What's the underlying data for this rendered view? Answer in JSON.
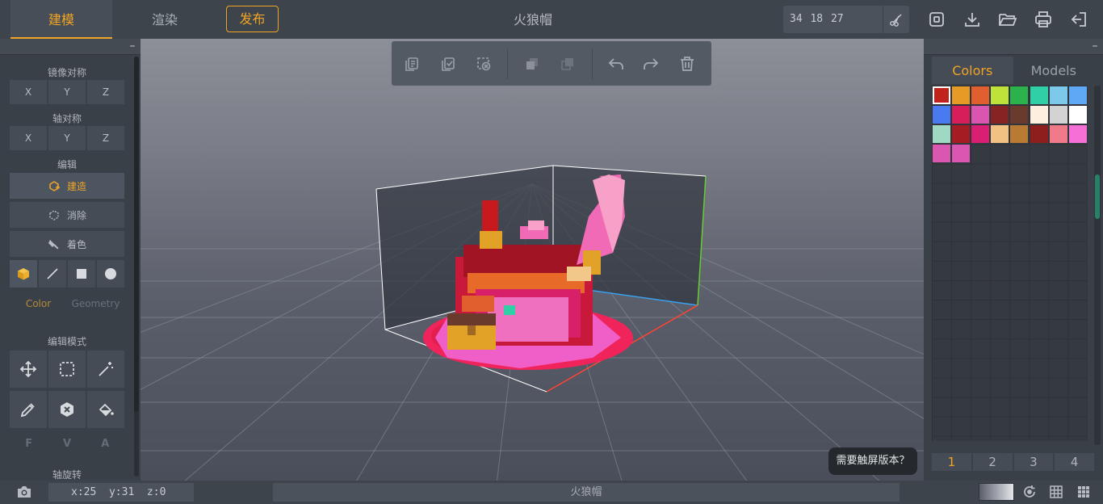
{
  "header": {
    "tabs": [
      {
        "label": "建模",
        "active": true
      },
      {
        "label": "渲染",
        "active": false
      }
    ],
    "publish_label": "发布",
    "title": "火狼帽",
    "dimensions": "34 18 27",
    "icons": [
      "scissors-icon",
      "save-icon",
      "download-icon",
      "open-folder-icon",
      "print-icon",
      "exit-icon"
    ]
  },
  "left_panel": {
    "mirror_label": "镜像对称",
    "mirror_axes": [
      "X",
      "Y",
      "Z"
    ],
    "axis_sym_label": "轴对称",
    "axis_sym_axes": [
      "X",
      "Y",
      "Z"
    ],
    "edit_label": "编辑",
    "tools": [
      {
        "label": "建造",
        "icon": "build-icon",
        "active": true
      },
      {
        "label": "消除",
        "icon": "erase-icon",
        "active": false
      },
      {
        "label": "着色",
        "icon": "paint-icon",
        "active": false
      }
    ],
    "shapes": [
      "cube-icon",
      "line-icon",
      "square-icon",
      "circle-icon"
    ],
    "mode_tabs": [
      {
        "label": "Color",
        "active": true
      },
      {
        "label": "Geometry",
        "active": false
      }
    ],
    "edit_mode_label": "编辑模式",
    "edit_mode_tools": [
      "move-icon",
      "select-rect-icon",
      "magic-wand-icon",
      "eyedropper-icon",
      "delete-hex-icon",
      "fill-bucket-icon"
    ],
    "fva": [
      "F",
      "V",
      "A"
    ],
    "rotate_label": "轴旋转"
  },
  "viewport": {
    "toolbar_icons": [
      "copy-icon",
      "paste-check-icon",
      "cut-clear-icon",
      "duplicate-icon",
      "merge-icon",
      "undo-icon",
      "redo-icon",
      "trash-icon"
    ],
    "touch_tip": "需要触屏版本？"
  },
  "right_panel": {
    "tabs": [
      {
        "label": "Colors",
        "active": true
      },
      {
        "label": "Models",
        "active": false
      }
    ],
    "palette": [
      "#c0221c",
      "#e89a26",
      "#e15f2e",
      "#bfe23a",
      "#2bb24c",
      "#2fd0a6",
      "#7cc9ec",
      "#5ea8f5",
      "#4a7af0",
      "#d81e5a",
      "#d955b0",
      "#862424",
      "#6a3a2c",
      "#fdeee0",
      "#d3d3d3",
      "#ffffff",
      "#9fd8c3",
      "#a51d23",
      "#d81f73",
      "#f1c184",
      "#b97a33",
      "#8e1e1e",
      "#f07a88",
      "#f46fd6",
      "#d957b0",
      "#d957b0"
    ],
    "selected_index": 0,
    "pages": [
      {
        "label": "1",
        "active": true
      },
      {
        "label": "2",
        "active": false
      },
      {
        "label": "3",
        "active": false
      },
      {
        "label": "4",
        "active": false
      }
    ]
  },
  "status_bar": {
    "coords": "x:25  y:31  z:0",
    "title": "火狼帽",
    "icons": [
      "camera-icon",
      "gradient-swatch",
      "rotate-icon",
      "grid-icon",
      "dense-grid-icon"
    ]
  }
}
